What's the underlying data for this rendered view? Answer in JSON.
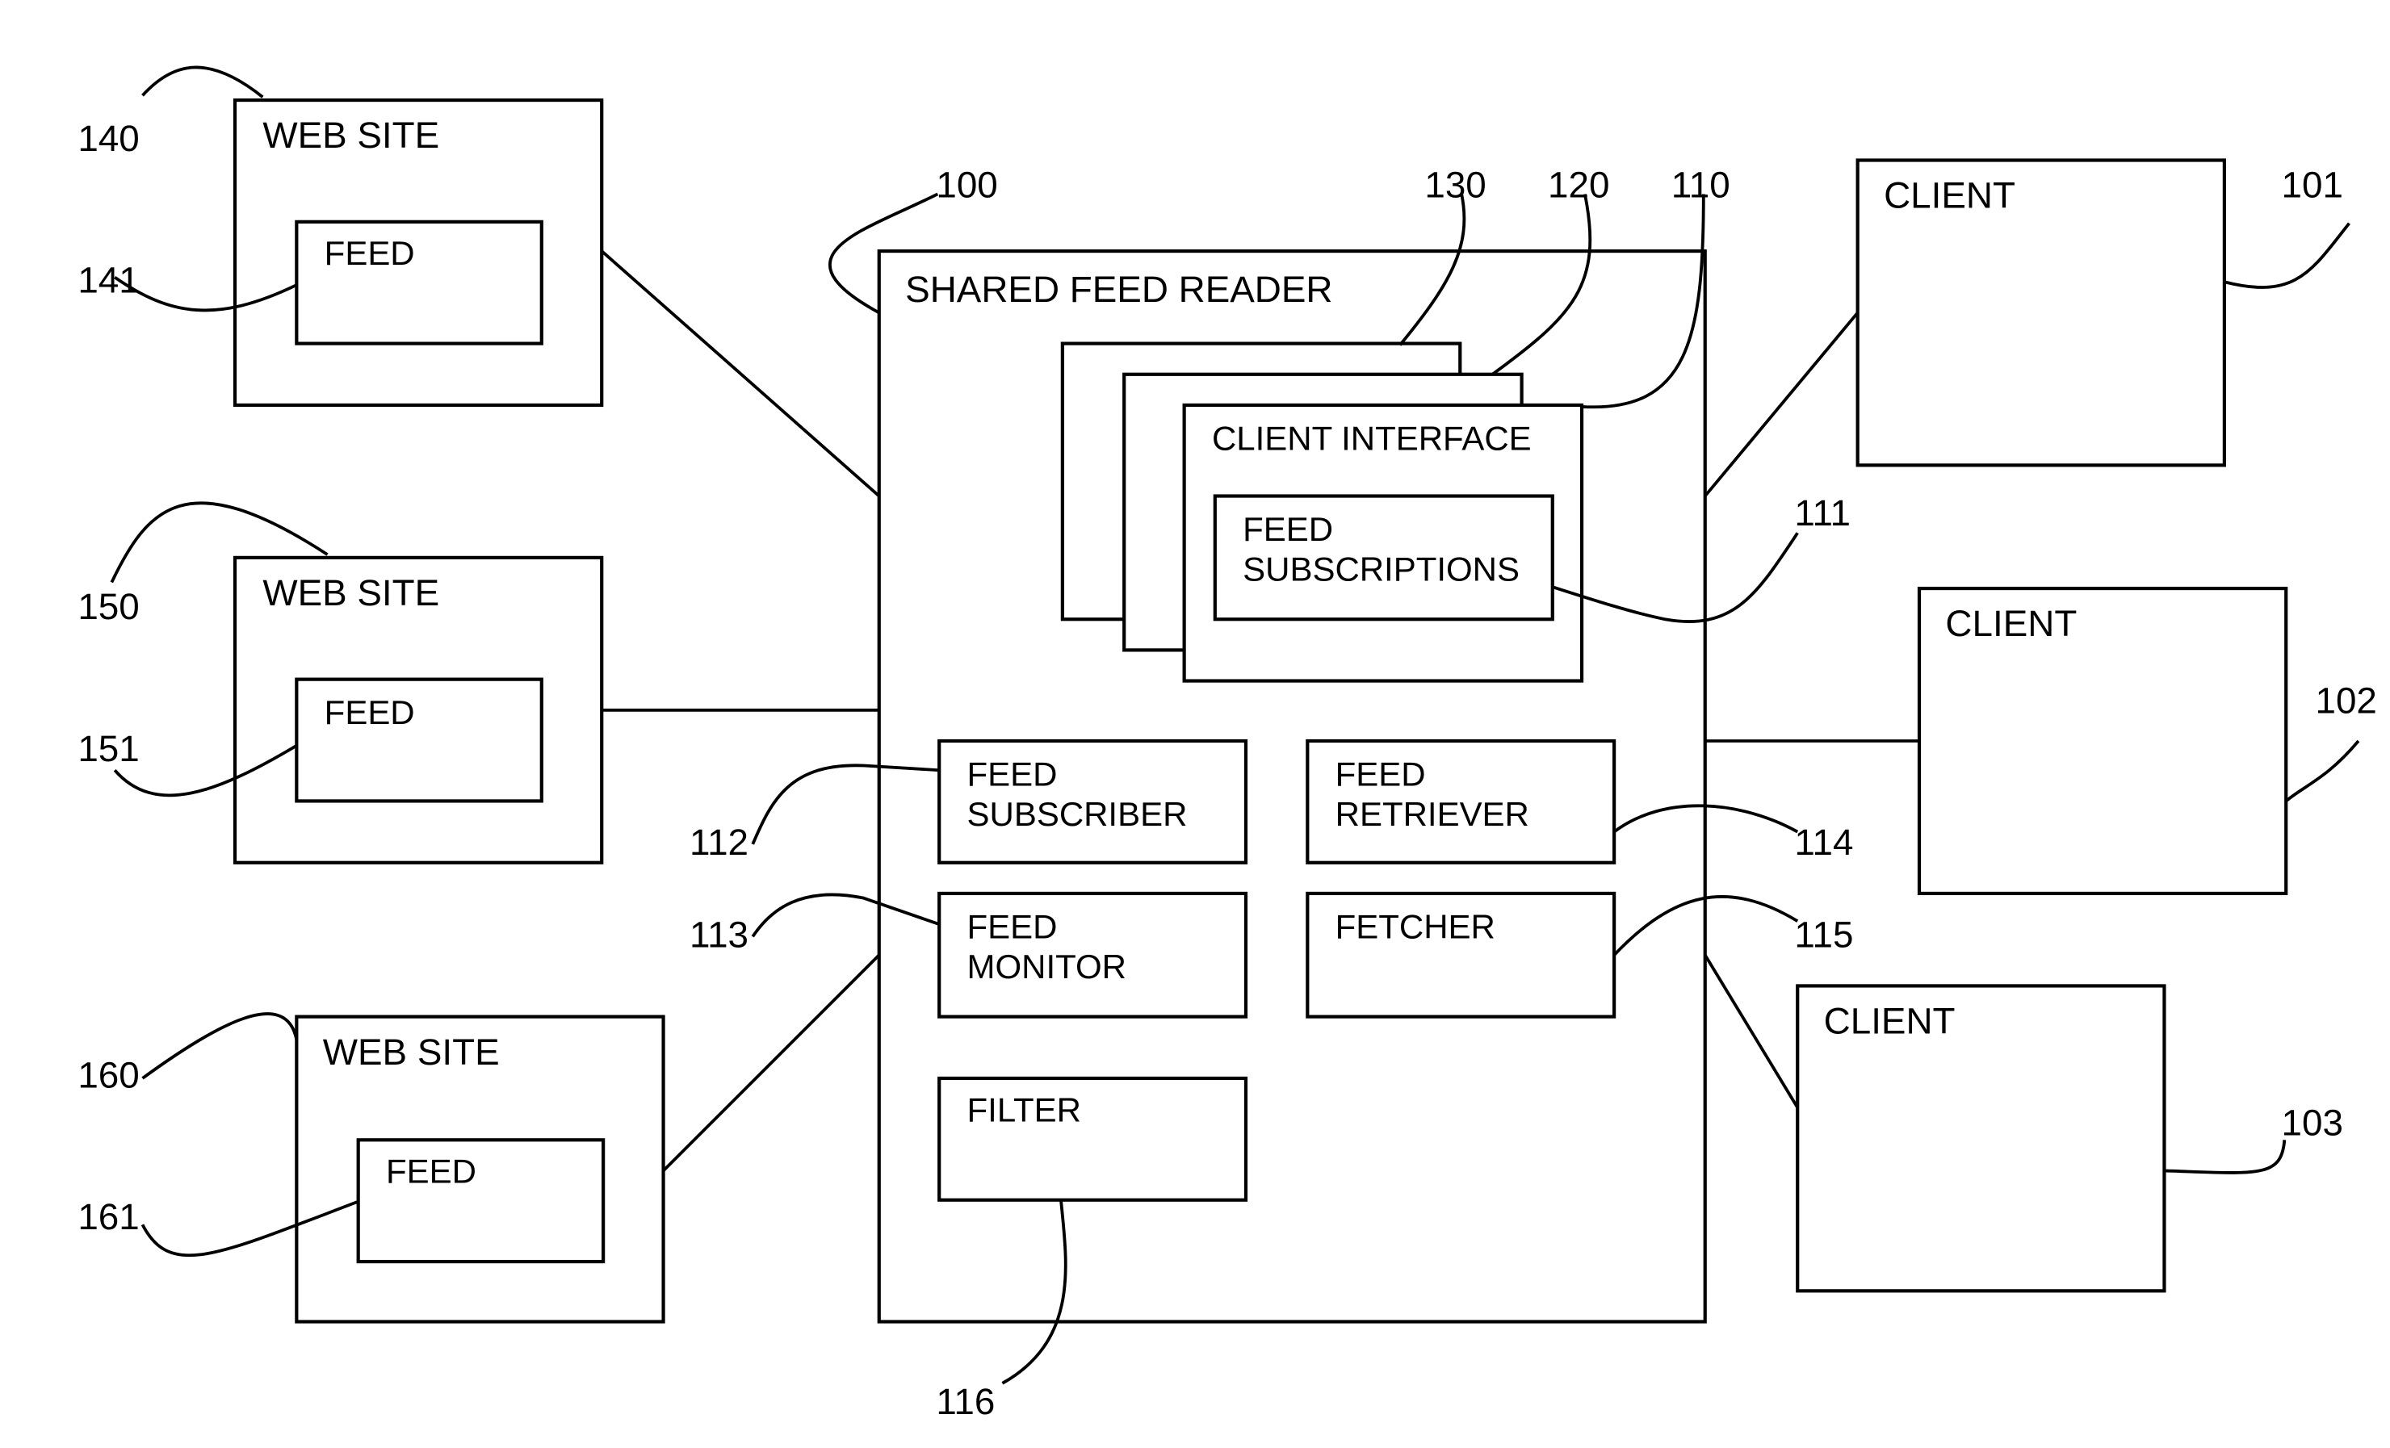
{
  "diagram": {
    "shared_feed_reader": {
      "title": "SHARED FEED READER",
      "ref": "100",
      "client_interfaces": {
        "refs": [
          "130",
          "120",
          "110"
        ],
        "title": "CLIENT INTERFACE",
        "feed_subscriptions": {
          "line1": "FEED",
          "line2": "SUBSCRIPTIONS",
          "ref": "111"
        }
      },
      "feed_subscriber": {
        "line1": "FEED",
        "line2": "SUBSCRIBER",
        "ref": "112"
      },
      "feed_monitor": {
        "line1": "FEED",
        "line2": "MONITOR",
        "ref": "113"
      },
      "feed_retriever": {
        "line1": "FEED",
        "line2": "RETRIEVER",
        "ref": "114"
      },
      "fetcher": {
        "line1": "FETCHER",
        "ref": "115"
      },
      "filter": {
        "line1": "FILTER",
        "ref": "116"
      }
    },
    "web_sites": [
      {
        "title": "WEB SITE",
        "ref": "140",
        "feed": {
          "title": "FEED",
          "ref": "141"
        }
      },
      {
        "title": "WEB SITE",
        "ref": "150",
        "feed": {
          "title": "FEED",
          "ref": "151"
        }
      },
      {
        "title": "WEB SITE",
        "ref": "160",
        "feed": {
          "title": "FEED",
          "ref": "161"
        }
      }
    ],
    "clients": [
      {
        "title": "CLIENT",
        "ref": "101"
      },
      {
        "title": "CLIENT",
        "ref": "102"
      },
      {
        "title": "CLIENT",
        "ref": "103"
      }
    ]
  }
}
